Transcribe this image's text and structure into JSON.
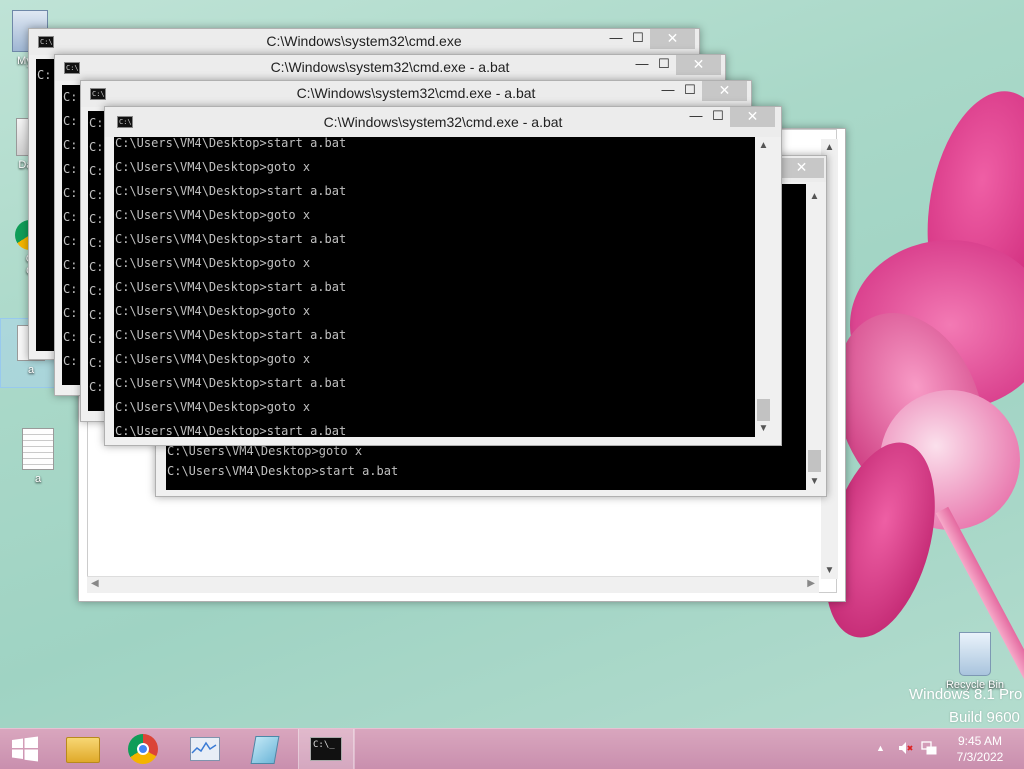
{
  "desktop": {
    "icons": [
      {
        "label": "My C"
      },
      {
        "label": "Data"
      },
      {
        "label": "G\nC"
      },
      {
        "label": "a"
      },
      {
        "label": "a"
      },
      {
        "label": "Recycle Bin"
      }
    ],
    "watermark_line1": "Windows 8.1 Pro",
    "watermark_line2": "Build 9600"
  },
  "windows": [
    {
      "title": "C:\\Windows\\system32\\cmd.exe",
      "lines": [
        "C:"
      ]
    },
    {
      "title": "C:\\Windows\\system32\\cmd.exe - a.bat",
      "lines": [
        "C:",
        "C:",
        "C:",
        "C:",
        "C:",
        "C:",
        "C:",
        "C:",
        "C:",
        "C:",
        "C:",
        "C:"
      ]
    },
    {
      "title": "C:\\Windows\\system32\\cmd.exe - a.bat",
      "lines": [
        "C:",
        "C:",
        "C:",
        "C:",
        "C:",
        "C:",
        "C:",
        "C:",
        "C:",
        "C:",
        "C:",
        "C:",
        "C:"
      ]
    },
    {
      "title": "C:\\Windows\\system32\\cmd.exe - a.bat",
      "lines": [
        "C:\\Users\\VM4\\Desktop>start a.bat",
        "C:\\Users\\VM4\\Desktop>goto x",
        "C:\\Users\\VM4\\Desktop>start a.bat",
        "C:\\Users\\VM4\\Desktop>goto x",
        "C:\\Users\\VM4\\Desktop>start a.bat",
        "C:\\Users\\VM4\\Desktop>goto x",
        "C:\\Users\\VM4\\Desktop>start a.bat",
        "C:\\Users\\VM4\\Desktop>goto x",
        "C:\\Users\\VM4\\Desktop>start a.bat",
        "C:\\Users\\VM4\\Desktop>goto x",
        "C:\\Users\\VM4\\Desktop>start a.bat",
        "C:\\Users\\VM4\\Desktop>goto x",
        "C:\\Users\\VM4\\Desktop>start a.bat"
      ]
    },
    {
      "title": "",
      "lines": [
        "C:\\Users\\VM4\\Desktop>goto x",
        "C:\\Users\\VM4\\Desktop>start a.bat"
      ]
    }
  ],
  "window_controls": {
    "minimize": "—",
    "maximize": "☐",
    "close": "✕"
  },
  "taskbar": {
    "time": "9:45 AM",
    "date": "7/3/2022"
  },
  "icons": {
    "start": "windows-start-icon",
    "explorer": "file-explorer-icon",
    "chrome": "chrome-icon",
    "monitor": "performance-monitor-icon",
    "notebook": "notepad-icon",
    "cmd": "command-prompt-icon",
    "tray_up": "show-hidden-icons-icon",
    "volume": "volume-muted-icon",
    "network": "network-icon"
  },
  "colors": {
    "taskbar": "#c98fae",
    "console_bg": "#000000",
    "console_text": "#c0c0c0",
    "close_button": "#c7c7c7"
  }
}
